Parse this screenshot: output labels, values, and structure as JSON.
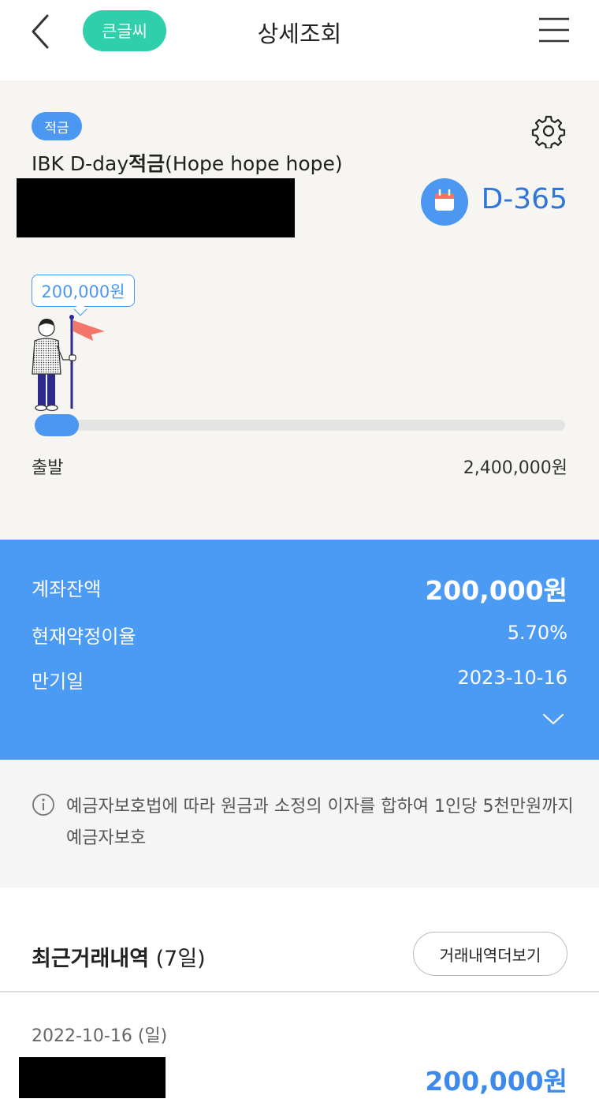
{
  "header": {
    "title": "상세조회",
    "big_font_label": "큰글씨",
    "back_icon": "chevron-left-icon",
    "menu_icon": "hamburger-menu-icon"
  },
  "product": {
    "tag": "적금",
    "name_prefix": "IBK D-day",
    "name_bold": "적금",
    "name_suffix": "(Hope hope hope)",
    "dday": "D-365",
    "current_amount_bubble": "200,000원",
    "progress_fraction": 0.083,
    "start_label": "출발",
    "goal_label": "2,400,000원",
    "colors": {
      "tag": "#4b97f2",
      "dday": "#2f76d6",
      "flag": "#f4756a"
    }
  },
  "balance": {
    "balance_label": "계좌잔액",
    "balance_value": "200,000원",
    "rate_label": "현재약정이율",
    "rate_value": "5.70%",
    "maturity_label": "만기일",
    "maturity_value": "2023-10-16",
    "color": "#4b9bf5"
  },
  "notice": {
    "text": "예금자보호법에 따라 원금과 소정의 이자를 합하여 1인당 5천만원까지 예금자보호"
  },
  "recent": {
    "title_bold": "최근거래내역",
    "title_suffix": " (7일)",
    "more_button": "거래내역더보기",
    "transactions": [
      {
        "date": "2022-10-16 (일)",
        "amount": "200,000원"
      }
    ]
  }
}
